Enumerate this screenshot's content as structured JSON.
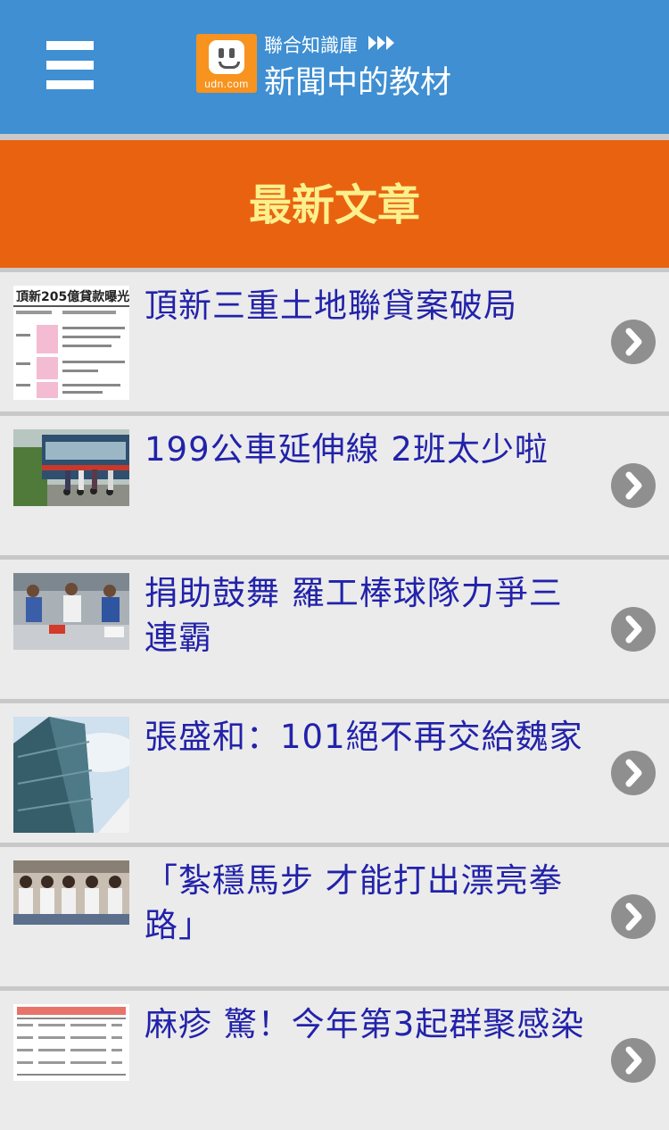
{
  "header": {
    "logo_text": "udn.com",
    "site_subtitle": "聯合知識庫",
    "site_title": "新聞中的教材"
  },
  "section": {
    "title": "最新文章"
  },
  "colors": {
    "header_bg": "#3f8fd2",
    "section_bg": "#e96210",
    "section_text": "#fbf08c",
    "title_text": "#2222aa",
    "arrow_button": "#8f8f8f"
  },
  "articles": [
    {
      "title": "頂新三重土地聯貸案破局",
      "thumb_caption": "頂新205億貸款曝光"
    },
    {
      "title": "199公車延伸線 2班太少啦"
    },
    {
      "title": "捐助鼓舞 羅工棒球隊力爭三連霸"
    },
    {
      "title": "張盛和：101絕不再交給魏家"
    },
    {
      "title": "「紮穩馬步 才能打出漂亮拳路」"
    },
    {
      "title": "麻疹 驚！今年第3起群聚感染"
    }
  ]
}
